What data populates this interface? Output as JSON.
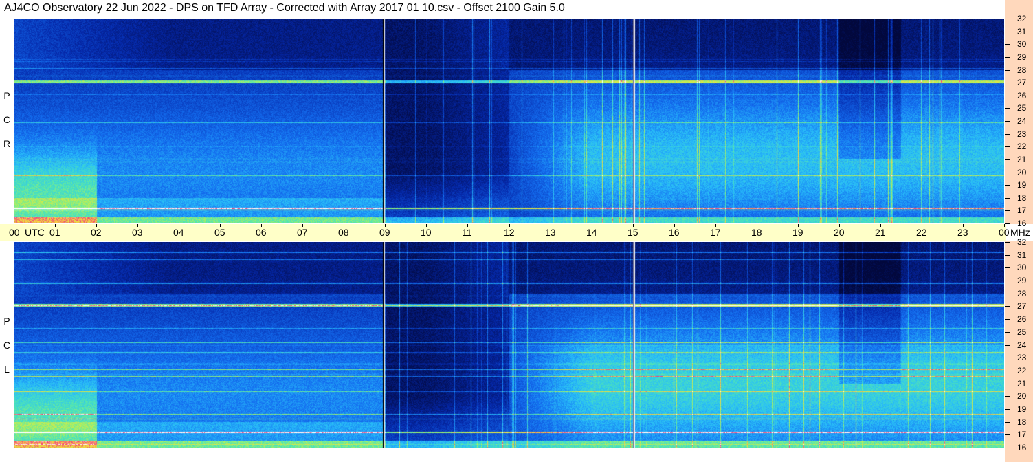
{
  "title": "AJ4CO Observatory  22 Jun 2022  -  DPS on TFD Array  -  Corrected with Array 2017 01 10.csv  -  Offset 2100  Gain 5.0",
  "panels": [
    {
      "id": "rcp",
      "letters": [
        "P",
        "C",
        "R"
      ]
    },
    {
      "id": "lcp",
      "letters": [
        "P",
        "C",
        "L"
      ]
    }
  ],
  "time_axis": {
    "labels": [
      "00",
      "01",
      "02",
      "03",
      "04",
      "05",
      "06",
      "07",
      "08",
      "09",
      "10",
      "11",
      "12",
      "13",
      "14",
      "15",
      "16",
      "17",
      "18",
      "19",
      "20",
      "21",
      "22",
      "23",
      "00"
    ],
    "unit": "UTC",
    "freq_unit": "MHz"
  },
  "colors": {
    "background": "#050a40",
    "axis_time": "#ffffc8",
    "axis_freq": "#ffd8bc"
  },
  "chart_data": {
    "type": "heatmap",
    "title": "AJ4CO Observatory  22 Jun 2022  -  DPS on TFD Array  -  Corrected with Array 2017 01 10.csv  -  Offset 2100  Gain 5.0",
    "x": {
      "label": "UTC",
      "range": [
        0,
        24
      ],
      "ticks": [
        "00",
        "01",
        "02",
        "03",
        "04",
        "05",
        "06",
        "07",
        "08",
        "09",
        "10",
        "11",
        "12",
        "13",
        "14",
        "15",
        "16",
        "17",
        "18",
        "19",
        "20",
        "21",
        "22",
        "23",
        "00"
      ]
    },
    "y": {
      "label": "MHz",
      "range": [
        16,
        32
      ],
      "ticks": [
        16,
        17,
        18,
        19,
        20,
        21,
        22,
        23,
        24,
        25,
        26,
        27,
        28,
        29,
        30,
        31,
        32
      ]
    },
    "series": [
      {
        "name": "RCP"
      },
      {
        "name": "LCP"
      }
    ],
    "features": {
      "vertical_markers_utc": [
        8.95,
        15.0
      ],
      "strong_band_mhz": 27.1,
      "intensity_scale": [
        "dark blue",
        "blue",
        "cyan",
        "green",
        "yellow",
        "red",
        "white"
      ]
    }
  }
}
